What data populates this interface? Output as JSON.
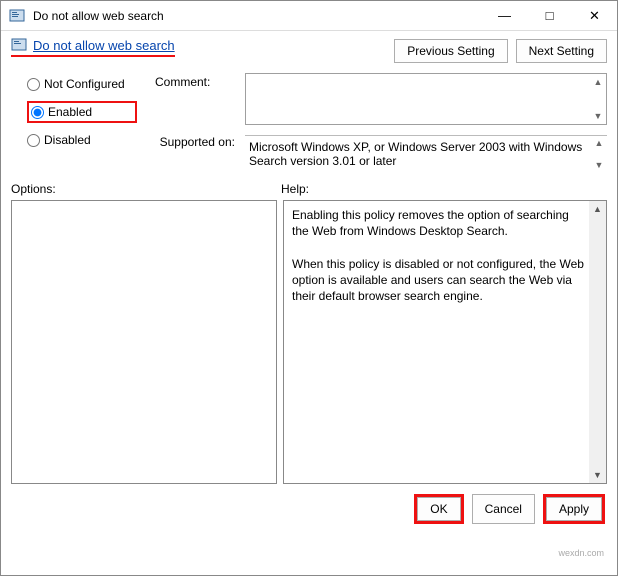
{
  "window": {
    "title": "Do not allow web search"
  },
  "header": {
    "policy_title": "Do not allow web search",
    "prev_btn": "Previous Setting",
    "next_btn": "Next Setting"
  },
  "radios": {
    "not_configured": "Not Configured",
    "enabled": "Enabled",
    "disabled": "Disabled",
    "selected": "enabled"
  },
  "details": {
    "comment_label": "Comment:",
    "comment_value": "",
    "supported_label": "Supported on:",
    "supported_value": "Microsoft Windows XP, or Windows Server 2003 with Windows Search version 3.01 or later"
  },
  "panes": {
    "options_label": "Options:",
    "help_label": "Help:",
    "help_p1": "Enabling this policy removes the option of searching the Web from Windows Desktop Search.",
    "help_p2": "When this policy is disabled or not configured, the Web option is available and users can search the Web via their default browser search engine."
  },
  "footer": {
    "ok": "OK",
    "cancel": "Cancel",
    "apply": "Apply"
  },
  "watermark": "wexdn.com"
}
